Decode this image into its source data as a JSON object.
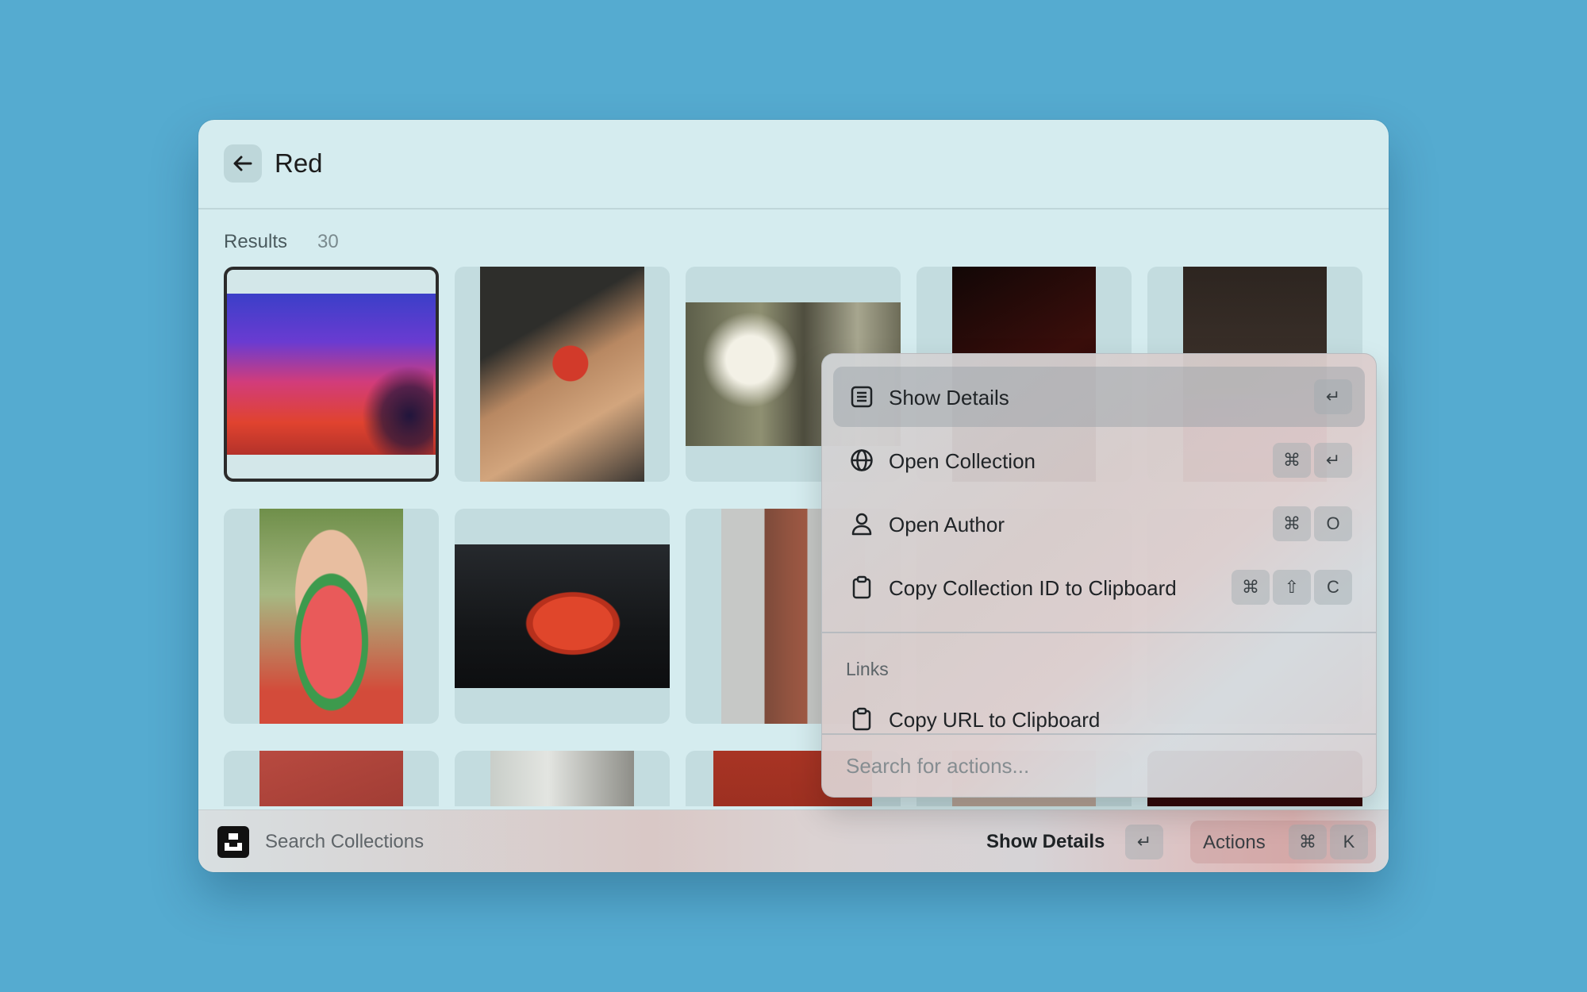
{
  "header": {
    "title": "Red"
  },
  "results": {
    "label": "Results",
    "count": "30"
  },
  "footer": {
    "search_placeholder": "Search Collections",
    "primary_action": "Show Details",
    "primary_shortcut": "↵",
    "actions_label": "Actions",
    "actions_shortcut": [
      "⌘",
      "K"
    ]
  },
  "action_panel": {
    "items": [
      {
        "label": "Show Details",
        "icon": "list-icon",
        "shortcut": [
          "↵"
        ]
      },
      {
        "label": "Open Collection",
        "icon": "globe-icon",
        "shortcut": [
          "⌘",
          "↵"
        ]
      },
      {
        "label": "Open Author",
        "icon": "person-icon",
        "shortcut": [
          "⌘",
          "O"
        ]
      },
      {
        "label": "Copy Collection ID to Clipboard",
        "icon": "clipboard-icon",
        "shortcut": [
          "⌘",
          "⇧",
          "C"
        ]
      }
    ],
    "section_title": "Links",
    "section_items": [
      {
        "label": "Copy URL to Clipboard",
        "icon": "clipboard-icon"
      }
    ],
    "search_placeholder": "Search for actions..."
  },
  "colors": {
    "background": "#55abd0",
    "window": "#d5ecef",
    "tile": "#c3dcdf",
    "selected_border": "#2b2b2b"
  }
}
